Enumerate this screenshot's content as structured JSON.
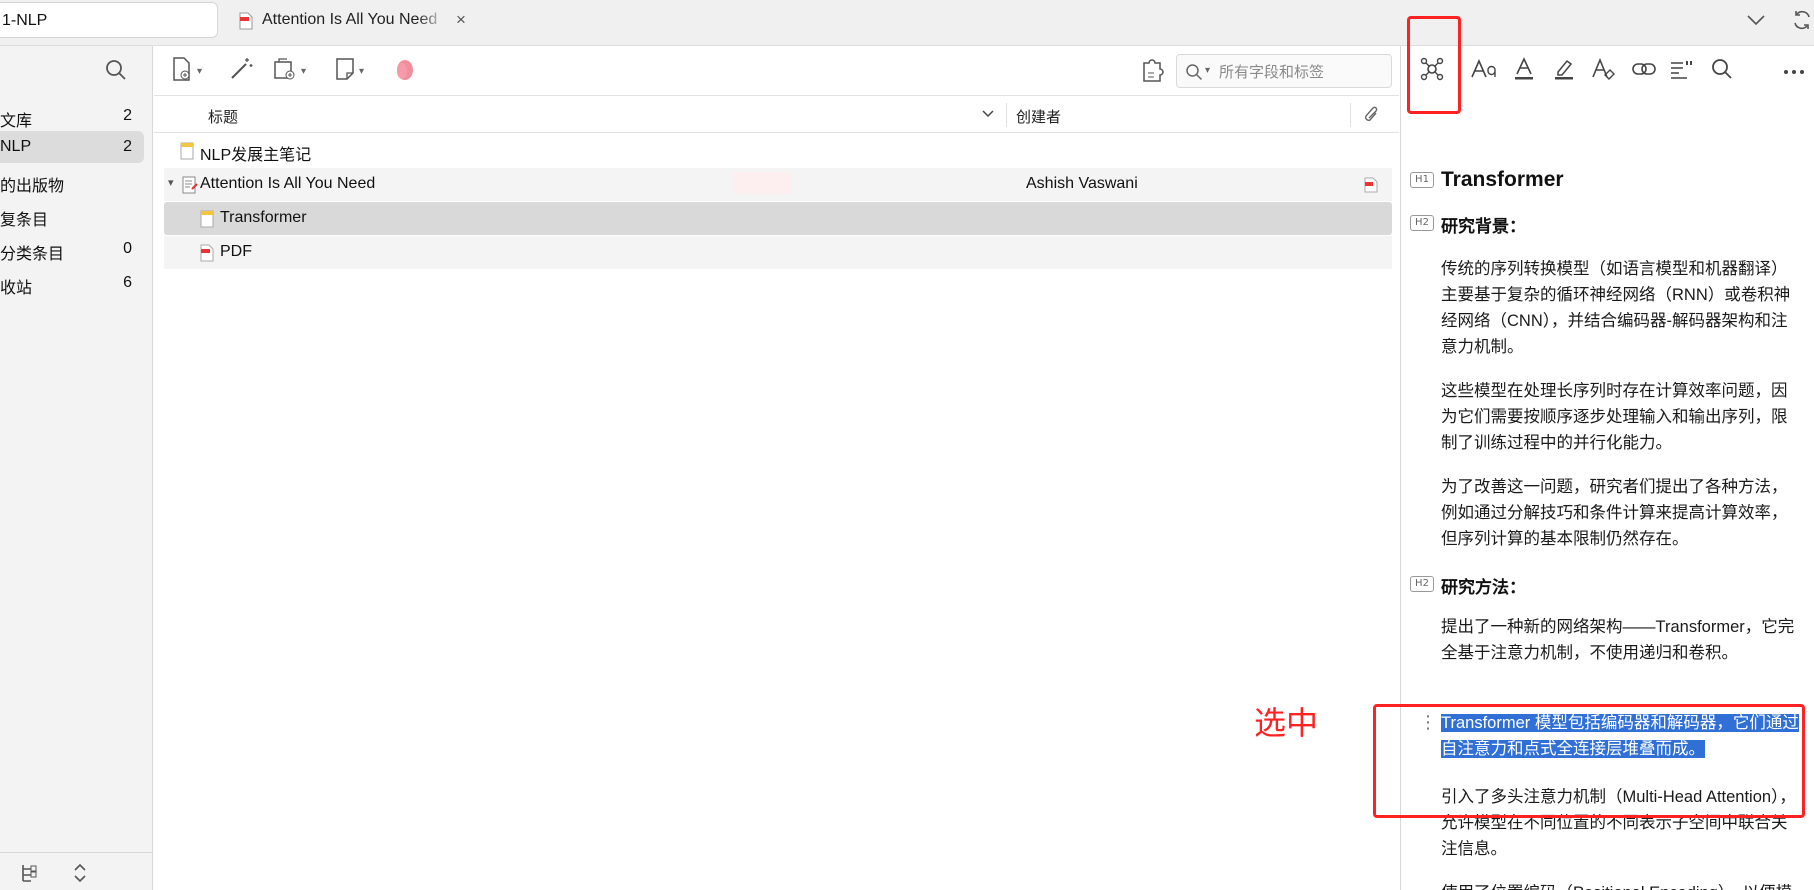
{
  "tabs": {
    "library_tab": "1-NLP",
    "doc_tab": "Attention Is All You Need",
    "close_glyph": "×"
  },
  "sidebar": {
    "items": [
      {
        "label": "文库",
        "count": "2"
      },
      {
        "label": "NLP",
        "count": "2"
      },
      {
        "label": "的出版物",
        "count": ""
      },
      {
        "label": "复条目",
        "count": ""
      },
      {
        "label": "分类条目",
        "count": "0"
      },
      {
        "label": "收站",
        "count": "6"
      }
    ]
  },
  "toolbar": {
    "search_placeholder": "所有字段和标签"
  },
  "columns": {
    "title": "标题",
    "creator": "创建者"
  },
  "rows": [
    {
      "title": "NLP发展主笔记",
      "creator": ""
    },
    {
      "title": "Attention Is All You Need",
      "creator": "Ashish Vaswani"
    },
    {
      "title": "Transformer",
      "creator": ""
    },
    {
      "title": "PDF",
      "creator": ""
    }
  ],
  "note": {
    "h1_tag": "H1",
    "h2_tag": "H2",
    "title": "Transformer",
    "section1": "研究背景：",
    "p1": "传统的序列转换模型（如语言模型和机器翻译）主要基于复杂的循环神经网络（RNN）或卷积神经网络（CNN），并结合编码器-解码器架构和注意力机制。",
    "p2": "这些模型在处理长序列时存在计算效率问题，因为它们需要按顺序逐步处理输入和输出序列，限制了训练过程中的并行化能力。",
    "p3": "为了改善这一问题，研究者们提出了各种方法，例如通过分解技巧和条件计算来提高计算效率，但序列计算的基本限制仍然存在。",
    "section2": "研究方法：",
    "p4": "提出了一种新的网络架构——Transformer，它完全基于注意力机制，不使用递归和卷积。",
    "p5": "Transformer 模型包括编码器和解码器，它们通过自注意力和点式全连接层堆叠而成。",
    "p6": "引入了多头注意力机制（Multi-Head Attention），允许模型在不同位置的不同表示子空间中联合关注信息。",
    "p7": "使用了位置编码（Positional Encoding），以便模型能够利用序列的顺序信息。"
  },
  "annotation": {
    "label": "选中",
    "color": "#ff2222"
  },
  "colors": {
    "selection": "#2f6fd6",
    "sidebar_bg": "#f3f3f3",
    "row_selected": "#d9d9d9"
  }
}
